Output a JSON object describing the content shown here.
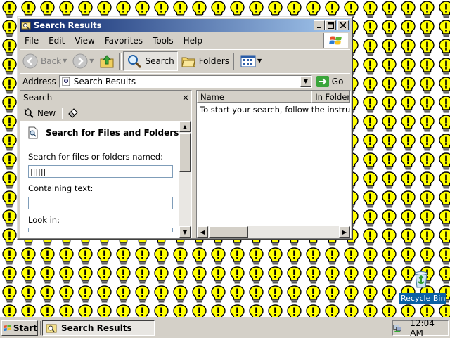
{
  "window": {
    "title": "Search Results",
    "controls": {
      "minimize": "_",
      "maximize": "□",
      "close": "✕"
    }
  },
  "menu": [
    "File",
    "Edit",
    "View",
    "Favorites",
    "Tools",
    "Help"
  ],
  "toolbar": {
    "back": "Back",
    "search": "Search",
    "folders": "Folders"
  },
  "address": {
    "label": "Address",
    "value": "Search Results",
    "go": "Go"
  },
  "search_pane": {
    "title": "Search",
    "close": "×",
    "new_label": "New",
    "heading": "Search for Files and Folders",
    "named_label": "Search for files or folders named:",
    "named_value": "||||||",
    "containing_label": "Containing text:",
    "containing_value": "",
    "lookin_label": "Look in:"
  },
  "results": {
    "columns": [
      "Name",
      "In Folder"
    ],
    "message": "To start your search, follow the instructions in the left pane."
  },
  "desktop": {
    "recycle_bin": "Recycle Bin"
  },
  "taskbar": {
    "start": "Start",
    "task": "Search Results",
    "clock": "12:04 AM"
  },
  "colors": {
    "title_gradient_start": "#0a246a",
    "title_gradient_end": "#a6caf0",
    "face": "#d4d0c8",
    "bulb": "#ffff00"
  }
}
